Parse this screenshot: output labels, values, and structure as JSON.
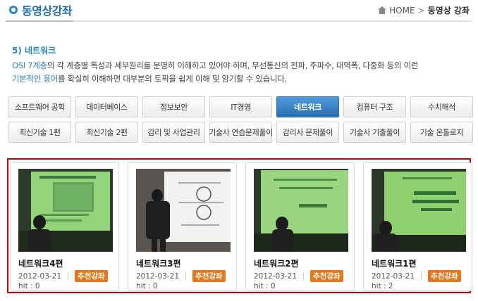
{
  "header": {
    "title": "동영상강좌",
    "breadcrumb": {
      "home": "HOME",
      "separator": ">",
      "current": "동영상 강좌"
    }
  },
  "intro": {
    "heading": "5) 네트워크",
    "hl1": "OSI 7계층",
    "text1": "의 각 계층별 특성과 세부원리를 분명히 이해하고 있어야 하며, 무선통신의 전파, 주파수, 대역폭, 다중화 등의 이런",
    "hl2": "기본적인 용어",
    "text2": "를 확실히 이해하면 대부분의 토픽을 쉽게 이해 및 암기할 수 있습니다."
  },
  "tabs": {
    "row1": [
      "소프트웨어 공학",
      "데이터베이스",
      "정보보안",
      "IT경영",
      "네트워크",
      "컴퓨터 구조",
      "수치해석"
    ],
    "row2": [
      "최신기술 1편",
      "최신기술 2편",
      "감리 및 사업관리",
      "기술사 연습문제풀이",
      "감리사 문제풀이",
      "기술사 기출풀이",
      "기술 온톨로지"
    ],
    "active": "네트워크"
  },
  "lectures": [
    {
      "title": "네트워크4편",
      "date": "2012-03-21",
      "badge": "추천강좌",
      "hit": "hit : 0"
    },
    {
      "title": "네트워크3편",
      "date": "2012-03-21",
      "badge": "추천강좌",
      "hit": "hit : 0"
    },
    {
      "title": "네트워크2편",
      "date": "2012-03-21",
      "badge": "추천강좌",
      "hit": "hit : 0"
    },
    {
      "title": "네트워크1편",
      "date": "2012-03-21",
      "badge": "추천강좌",
      "hit": "hit : 2"
    }
  ],
  "colors": {
    "accent": "#2b86c4",
    "tab_active": "#2a6fb5",
    "badge": "#e7771a",
    "panel_border": "#d40000"
  }
}
